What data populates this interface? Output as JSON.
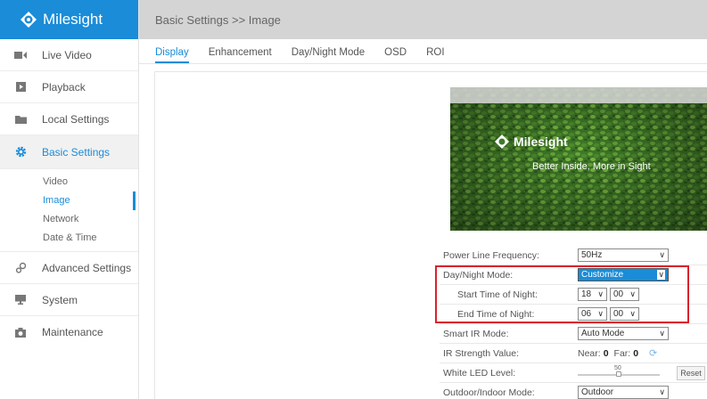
{
  "brand": {
    "name": "Milesight",
    "color": "#1a8cd8"
  },
  "sidebar": {
    "items": [
      {
        "label": "Live Video",
        "icon": "video-icon"
      },
      {
        "label": "Playback",
        "icon": "playback-icon"
      },
      {
        "label": "Local Settings",
        "icon": "folder-icon"
      },
      {
        "label": "Basic Settings",
        "icon": "gear-icon",
        "active": true
      },
      {
        "label": "Advanced Settings",
        "icon": "advanced-gears-icon"
      },
      {
        "label": "System",
        "icon": "monitor-icon"
      },
      {
        "label": "Maintenance",
        "icon": "camera-icon"
      }
    ],
    "subitems": [
      {
        "label": "Video"
      },
      {
        "label": "Image",
        "active": true
      },
      {
        "label": "Network"
      },
      {
        "label": "Date & Time"
      }
    ]
  },
  "header": {
    "breadcrumb": "Basic Settings >> Image"
  },
  "tabs": [
    {
      "label": "Display",
      "active": true
    },
    {
      "label": "Enhancement"
    },
    {
      "label": "Day/Night Mode"
    },
    {
      "label": "OSD"
    },
    {
      "label": "ROI"
    }
  ],
  "preview": {
    "logo_text": "Milesight",
    "slogan": "Better Inside, More in Sight"
  },
  "settings": {
    "power_line": {
      "label": "Power Line Frequency:",
      "value": "50Hz"
    },
    "day_night": {
      "label": "Day/Night Mode:",
      "value": "Customize"
    },
    "start_night": {
      "label": "Start Time of Night:",
      "hour": "18",
      "minute": "00"
    },
    "end_night": {
      "label": "End Time of Night:",
      "hour": "06",
      "minute": "00"
    },
    "smart_ir": {
      "label": "Smart IR Mode:",
      "value": "Auto Mode"
    },
    "ir_strength": {
      "label": "IR Strength Value:",
      "near_label": "Near:",
      "near_value": "0",
      "far_label": "Far:",
      "far_value": "0"
    },
    "white_led": {
      "label": "White LED Level:",
      "slider_value": "50",
      "level_fraction": 0.5,
      "reset_label": "Reset"
    },
    "outdoor_indoor": {
      "label": "Outdoor/Indoor Mode:",
      "value": "Outdoor"
    }
  },
  "colors": {
    "accent": "#1a8cd8",
    "highlight_box": "#d9232c",
    "header_bg": "#d4d4d4"
  }
}
